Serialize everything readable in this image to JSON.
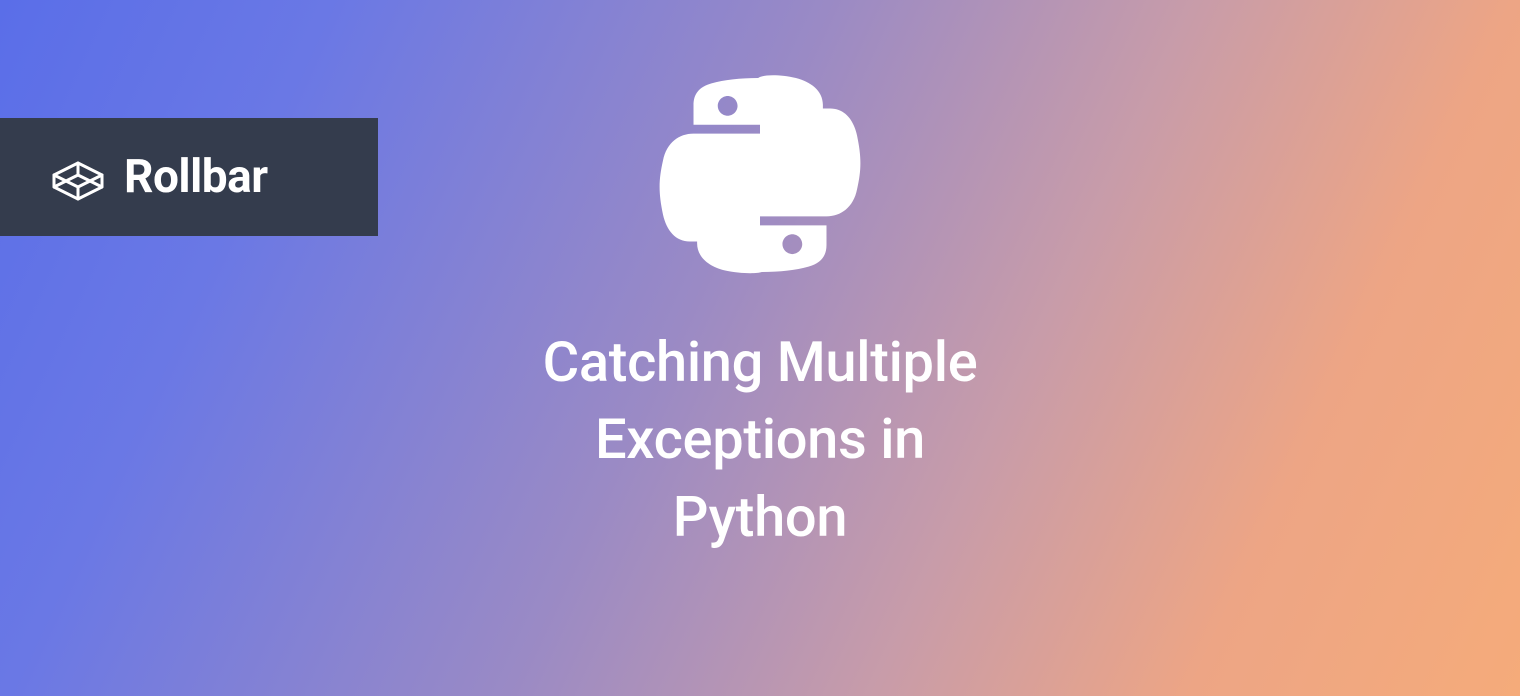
{
  "brand": {
    "name": "Rollbar"
  },
  "title": "Catching Multiple\nExceptions in\nPython",
  "colors": {
    "badge_bg": "#343c4d",
    "text": "#ffffff"
  }
}
